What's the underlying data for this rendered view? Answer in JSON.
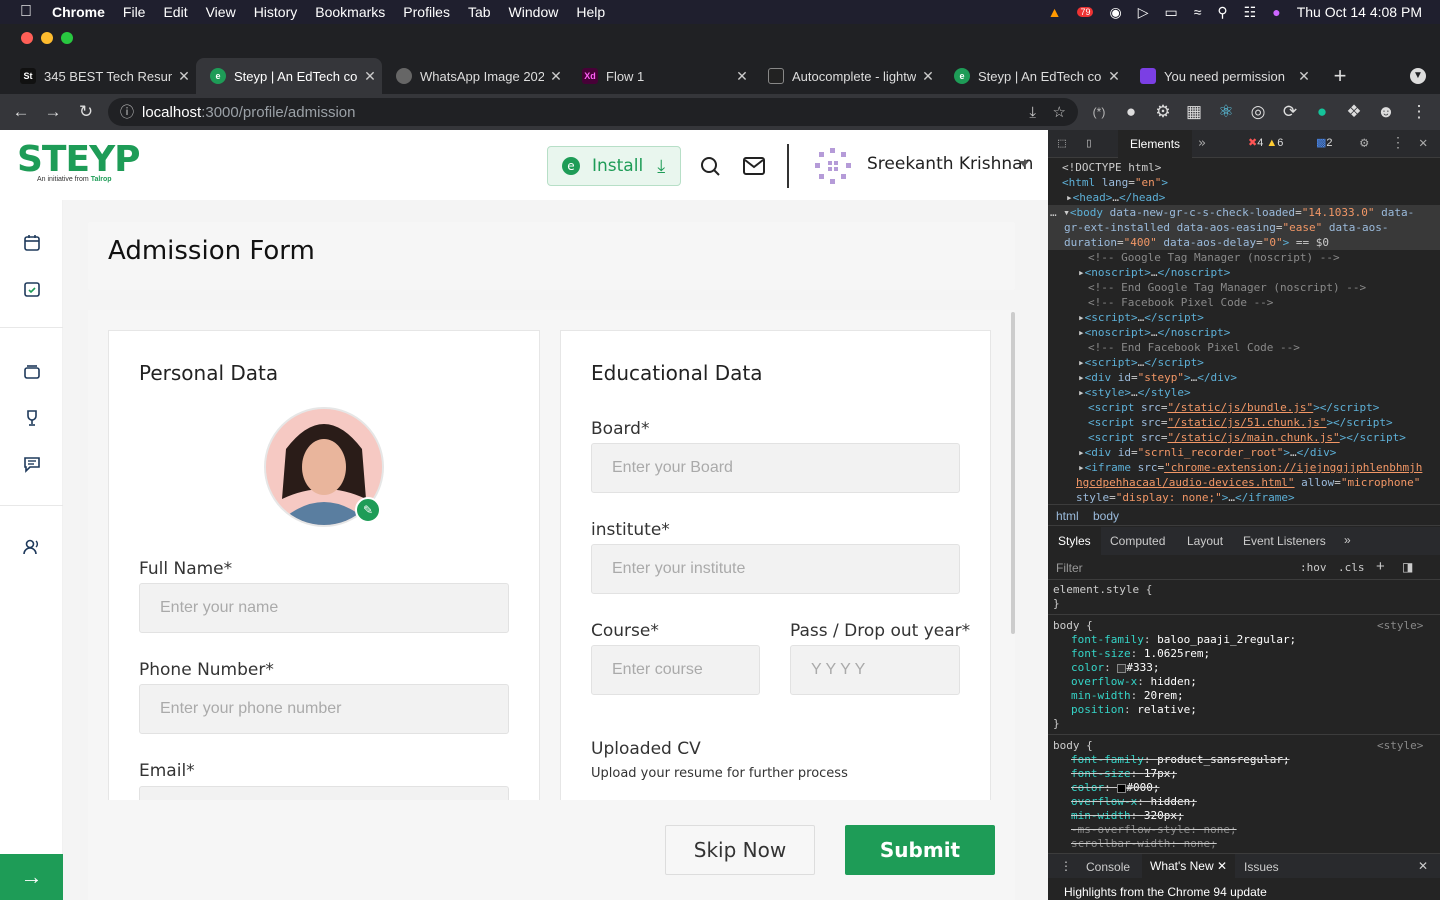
{
  "mac_menu": {
    "app": "Chrome",
    "items": [
      "File",
      "Edit",
      "View",
      "History",
      "Bookmarks",
      "Profiles",
      "Tab",
      "Window",
      "Help"
    ],
    "clock": "Thu Oct 14  4:08 PM",
    "badge": "79"
  },
  "tabs": [
    {
      "title": "345 BEST Tech Resum",
      "fav": "St",
      "fav_color": "#111"
    },
    {
      "title": "Steyp | An EdTech cor",
      "fav": "e",
      "fav_color": "#1e9c57"
    },
    {
      "title": "WhatsApp Image 202",
      "fav": "",
      "fav_color": "#666"
    },
    {
      "title": "Flow 1",
      "fav": "Xd",
      "fav_color": "#470137"
    },
    {
      "title": "Autocomplete - lightw",
      "fav": "",
      "fav_color": "#444"
    },
    {
      "title": "Steyp | An EdTech cor",
      "fav": "e",
      "fav_color": "#1e9c57"
    },
    {
      "title": "You need permission",
      "fav": "",
      "fav_color": "#7b3fe4"
    }
  ],
  "url": {
    "host": "localhost",
    "path": ":3000/profile/admission"
  },
  "header": {
    "logo": "STEYP",
    "logo_sub": "An initiative from",
    "logo_sub_brand": "Talrop",
    "install_label": "Install",
    "user_name": "Sreekanth Krishnan"
  },
  "page_title": "Admission Form",
  "personal": {
    "title": "Personal Data",
    "full_name_label": "Full Name*",
    "full_name_placeholder": "Enter your  name",
    "phone_label": "Phone Number*",
    "phone_placeholder": "Enter your  phone number",
    "email_label": "Email*"
  },
  "education": {
    "title": "Educational Data",
    "board_label": "Board*",
    "board_placeholder": "Enter your  Board",
    "institute_label": "institute*",
    "institute_placeholder": "Enter your  institute",
    "course_label": "Course*",
    "course_placeholder": "Enter course",
    "year_label": "Pass / Drop out year*",
    "year_placeholder": "Y Y Y Y",
    "cv_label": "Uploaded CV",
    "cv_sub": "Upload your resume for further process"
  },
  "actions": {
    "skip": "Skip Now",
    "submit": "Submit"
  },
  "devtools": {
    "tabs": {
      "elements": "Elements",
      "errors": "4",
      "warnings": "6",
      "messages": "2"
    },
    "breadcrumb": [
      "html",
      "body"
    ],
    "style_tabs": [
      "Styles",
      "Computed",
      "Layout",
      "Event Listeners"
    ],
    "filter_placeholder": "Filter",
    "hov": ":hov",
    "cls": ".cls",
    "drawer_tabs": [
      "Console",
      "What's New",
      "Issues"
    ],
    "drawer_text": "Highlights from the Chrome 94 update"
  },
  "colors": {
    "brand_green": "#1e9c57",
    "devtools_bg": "#242424"
  }
}
